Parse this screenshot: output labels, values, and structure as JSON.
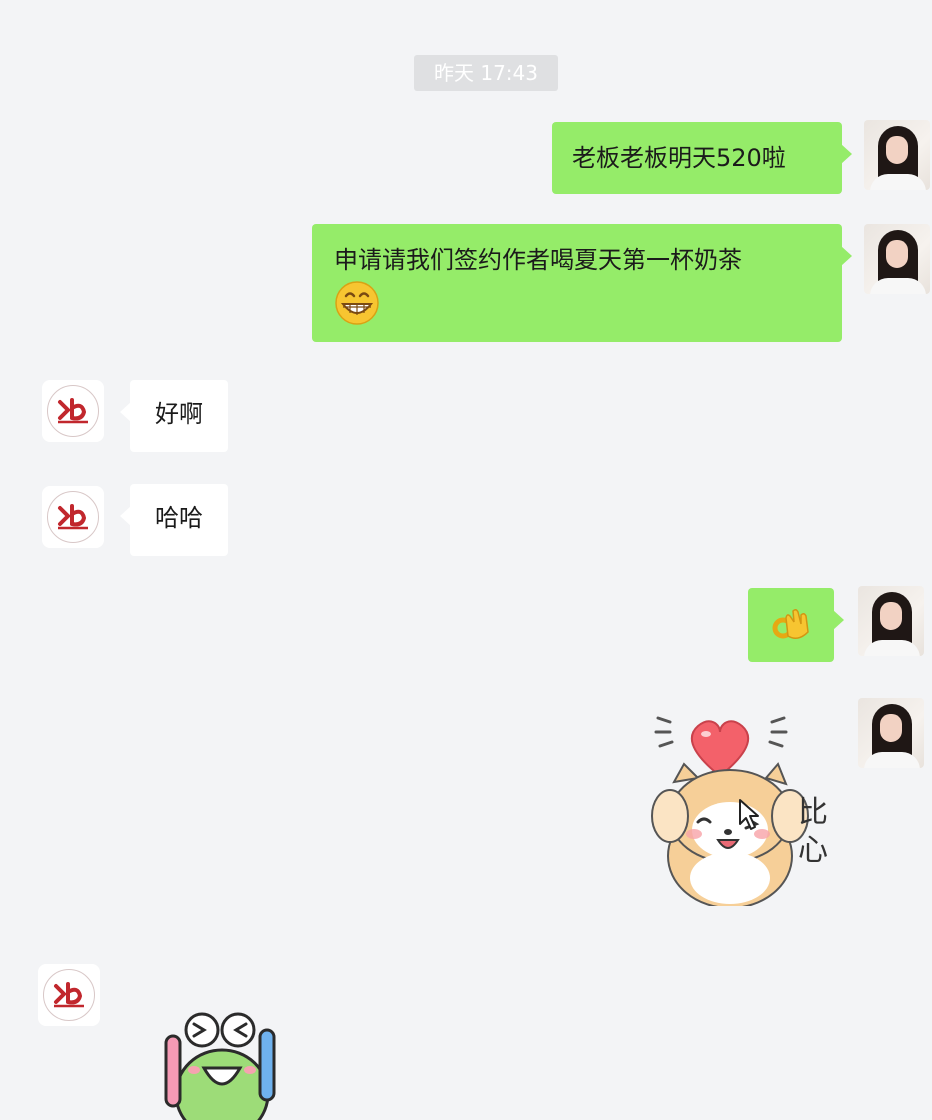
{
  "timestamp": "昨天 17:43",
  "messages": [
    {
      "sender": "me",
      "text": "老板老板明天520啦"
    },
    {
      "sender": "me",
      "text": "申请请我们签约作者喝夏天第一杯奶茶",
      "emoji": "grinning-emoji"
    },
    {
      "sender": "other",
      "text": "好啊"
    },
    {
      "sender": "other",
      "text": "哈哈"
    },
    {
      "sender": "me",
      "emoji": "ok-hand-emoji"
    },
    {
      "sender": "me",
      "sticker": "heart-cat-sticker",
      "sticker_text": "比心"
    },
    {
      "sender": "other",
      "sticker": "frog-sticker"
    }
  ],
  "colors": {
    "background": "#f3f4f6",
    "my_bubble": "#95ec69",
    "other_bubble": "#ffffff",
    "timestamp_bg": "#dfe0e2"
  }
}
